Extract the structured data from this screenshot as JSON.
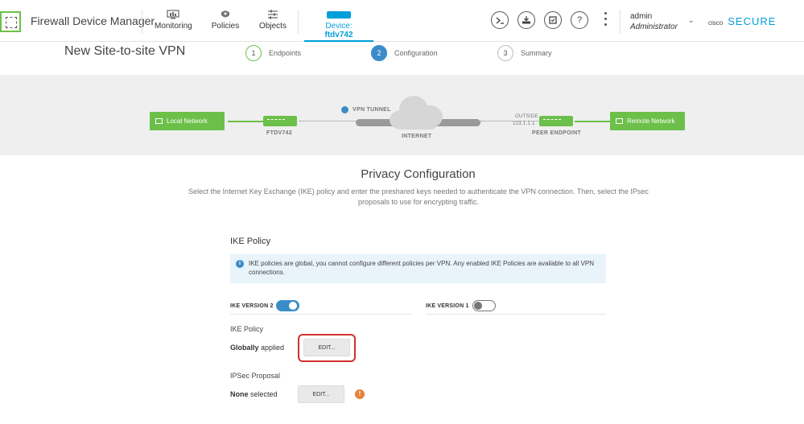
{
  "header": {
    "app_title": "Firewall Device Manager",
    "nav": [
      {
        "label": "Monitoring"
      },
      {
        "label": "Policies"
      },
      {
        "label": "Objects"
      }
    ],
    "device_prefix": "Device: ",
    "device_name": "ftdv742",
    "user_name": "admin",
    "user_role": "Administrator",
    "brand_cisco": "cisco",
    "brand_secure": "SECURE",
    "help_glyph": "?"
  },
  "wizard": {
    "title": "New Site-to-site VPN",
    "steps": [
      {
        "number": "1",
        "label": "Endpoints",
        "state": "complete"
      },
      {
        "number": "2",
        "label": "Configuration",
        "state": "active"
      },
      {
        "number": "3",
        "label": "Summary",
        "state": "upcoming"
      }
    ]
  },
  "diagram": {
    "local_network": "Local Network",
    "remote_network": "Remote Network",
    "local_device": "FTDV742",
    "vpn_tunnel": "VPN TUNNEL",
    "internet": "INTERNET",
    "outside_label": "OUTSIDE",
    "outside_ip": "123.1.1.1",
    "peer_endpoint": "PEER ENDPOINT"
  },
  "privacy": {
    "title": "Privacy Configuration",
    "description": "Select the Internet Key Exchange (IKE) policy and enter the preshared keys needed to authenticate the VPN connection. Then, select the IPsec proposals to use for encrypting traffic."
  },
  "ike": {
    "heading": "IKE Policy",
    "info_glyph": "i",
    "info_text": "IKE policies are global, you cannot configure different policies per VPN. Any enabled IKE Policies are available to all VPN connections.",
    "version2_label": "IKE VERSION 2",
    "version2_enabled": true,
    "version1_label": "IKE VERSION 1",
    "version1_enabled": false,
    "policy_label": "IKE Policy",
    "policy_status_bold": "Globally",
    "policy_status_rest": " applied",
    "policy_edit": "EDIT..."
  },
  "ipsec": {
    "label": "IPSec Proposal",
    "status_bold": "None",
    "status_rest": " selected",
    "edit": "EDIT...",
    "warn_glyph": "!"
  },
  "colors": {
    "accent": "#049fd9",
    "green": "#6cc04a",
    "highlight": "#d0312d",
    "warning": "#e8803a"
  }
}
